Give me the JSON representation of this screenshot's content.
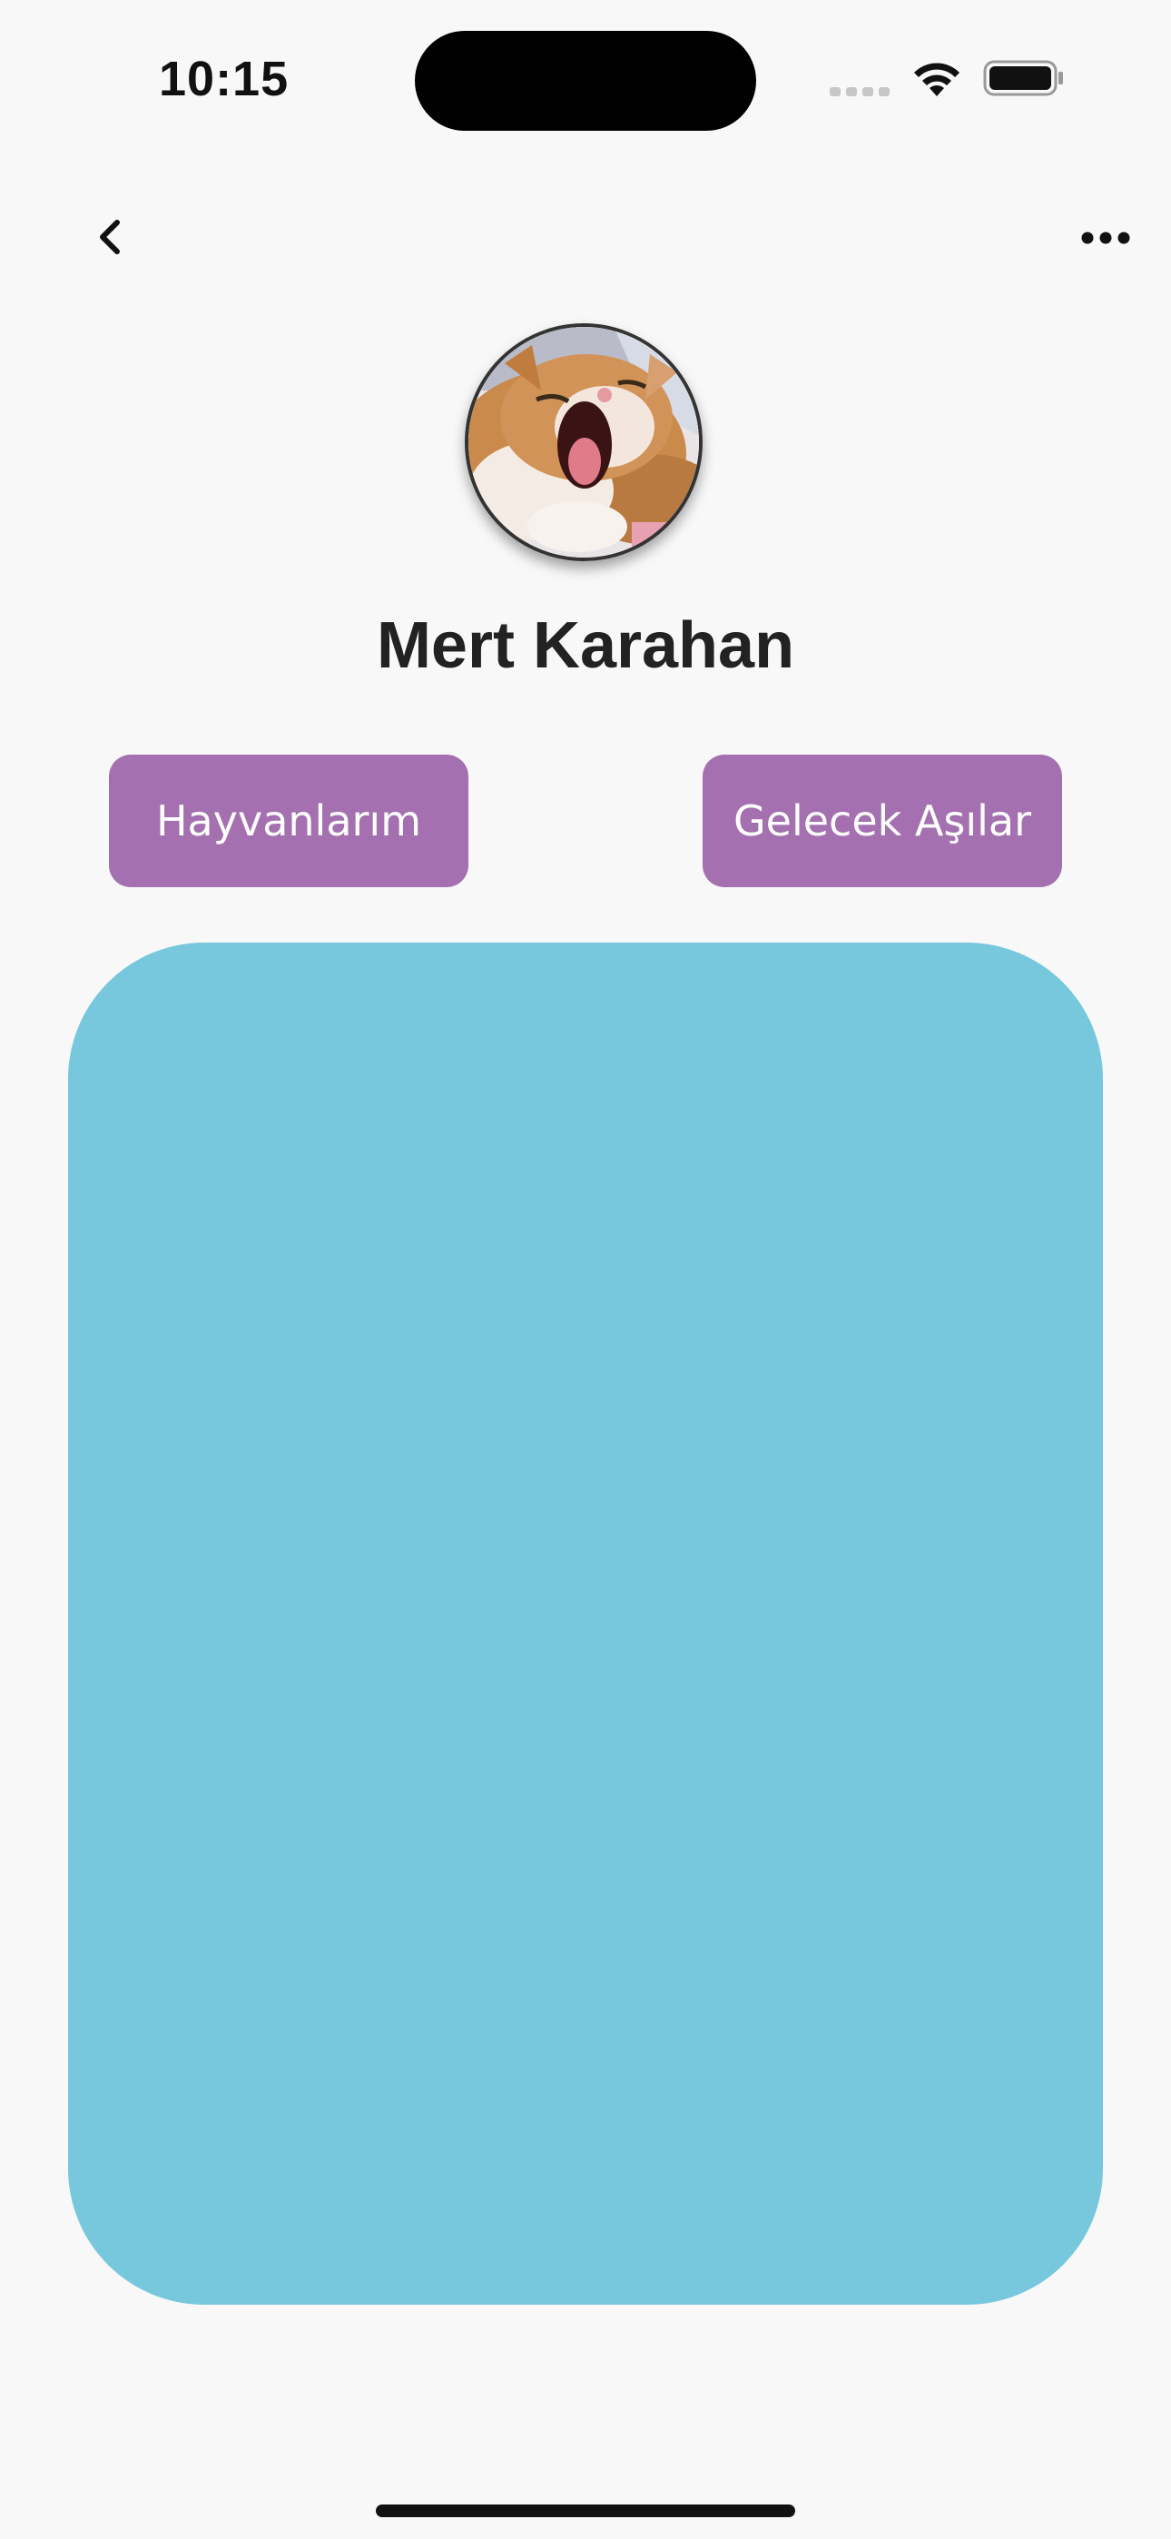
{
  "status_bar": {
    "time": "10:15",
    "icons": [
      "cellular-signal-icon",
      "wifi-icon",
      "battery-icon"
    ]
  },
  "nav_bar": {
    "back_icon": "chevron-left-icon",
    "more_icon": "ellipsis-icon"
  },
  "profile": {
    "avatar": "cat-yawning-photo",
    "name": "Mert Karahan"
  },
  "actions": {
    "pets_label": "Hayvanlarım",
    "vaccines_label": "Gelecek Aşılar"
  },
  "colors": {
    "background": "#f8f8f8",
    "button": "#a470b0",
    "card": "#77c8dd",
    "name_text": "#222222"
  }
}
